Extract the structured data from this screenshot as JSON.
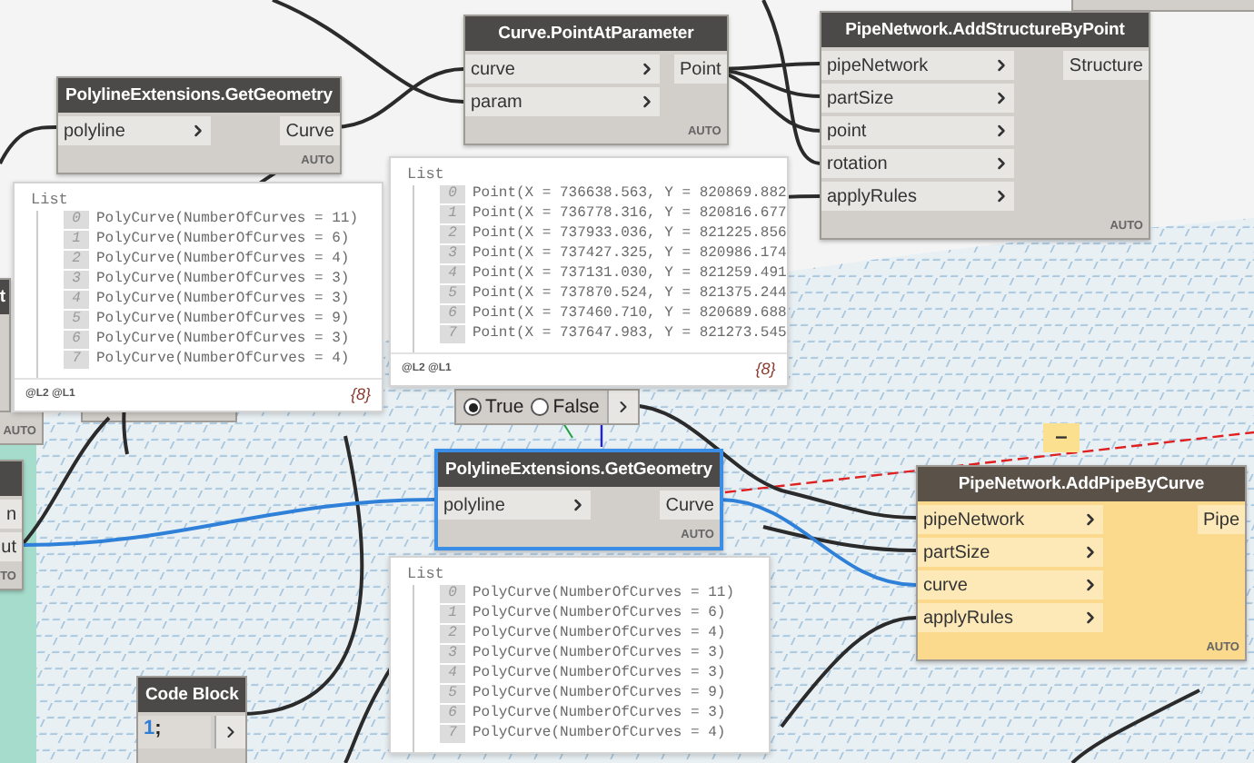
{
  "nodes": [
    {
      "title": "PolylineExtensions.GetGeometry",
      "selected": false,
      "warning": false,
      "inputs": [
        "polyline"
      ],
      "outputs": [
        "Curve"
      ],
      "lacing": "AUTO"
    },
    {
      "title": "Curve.PointAtParameter",
      "selected": false,
      "warning": false,
      "inputs": [
        "curve",
        "param"
      ],
      "outputs": [
        "Point"
      ],
      "lacing": "AUTO"
    },
    {
      "title": "PipeNetwork.AddStructureByPoint",
      "selected": false,
      "warning": false,
      "inputs": [
        "pipeNetwork",
        "partSize",
        "point",
        "rotation",
        "applyRules"
      ],
      "outputs": [
        "Structure"
      ],
      "lacing": "AUTO"
    },
    {
      "title": "t",
      "selected": false,
      "warning": false,
      "lacing": "AUTO"
    },
    {
      "selected": false,
      "warning": false,
      "outputs": [
        "n",
        "ut"
      ],
      "lacing": "TO"
    },
    {
      "title": "PolylineExtensions.GetGeometry",
      "selected": true,
      "warning": false,
      "inputs": [
        "polyline"
      ],
      "outputs": [
        "Curve"
      ],
      "lacing": "AUTO"
    },
    {
      "title": "PipeNetwork.AddPipeByCurve",
      "selected": false,
      "warning": true,
      "inputs": [
        "pipeNetwork",
        "partSize",
        "curve",
        "applyRules"
      ],
      "outputs": [
        "Pipe"
      ],
      "lacing": "AUTO"
    }
  ],
  "previews": [
    {
      "header": "List",
      "items": [
        {
          "index": "0",
          "text": "PolyCurve(NumberOfCurves = 11)"
        },
        {
          "index": "1",
          "text": "PolyCurve(NumberOfCurves = 6)"
        },
        {
          "index": "2",
          "text": "PolyCurve(NumberOfCurves = 4)"
        },
        {
          "index": "3",
          "text": "PolyCurve(NumberOfCurves = 3)"
        },
        {
          "index": "4",
          "text": "PolyCurve(NumberOfCurves = 3)"
        },
        {
          "index": "5",
          "text": "PolyCurve(NumberOfCurves = 9)"
        },
        {
          "index": "6",
          "text": "PolyCurve(NumberOfCurves = 3)"
        },
        {
          "index": "7",
          "text": "PolyCurve(NumberOfCurves = 4)"
        }
      ],
      "levels": [
        "@L2",
        "@L1"
      ],
      "count": "{8}"
    },
    {
      "header": "List",
      "items": [
        {
          "index": "0",
          "text": "Point(X = 736638.563, Y = 820869.882"
        },
        {
          "index": "1",
          "text": "Point(X = 736778.316, Y = 820816.677"
        },
        {
          "index": "2",
          "text": "Point(X = 737933.036, Y = 821225.856"
        },
        {
          "index": "3",
          "text": "Point(X = 737427.325, Y = 820986.174"
        },
        {
          "index": "4",
          "text": "Point(X = 737131.030, Y = 821259.491"
        },
        {
          "index": "5",
          "text": "Point(X = 737870.524, Y = 821375.244"
        },
        {
          "index": "6",
          "text": "Point(X = 737460.710, Y = 820689.688"
        },
        {
          "index": "7",
          "text": "Point(X = 737647.983, Y = 821273.545"
        }
      ],
      "levels": [
        "@L2",
        "@L1"
      ],
      "count": "{8}"
    },
    {
      "header": "List",
      "items": [
        {
          "index": "0",
          "text": "PolyCurve(NumberOfCurves = 11)"
        },
        {
          "index": "1",
          "text": "PolyCurve(NumberOfCurves = 6)"
        },
        {
          "index": "2",
          "text": "PolyCurve(NumberOfCurves = 4)"
        },
        {
          "index": "3",
          "text": "PolyCurve(NumberOfCurves = 3)"
        },
        {
          "index": "4",
          "text": "PolyCurve(NumberOfCurves = 3)"
        },
        {
          "index": "5",
          "text": "PolyCurve(NumberOfCurves = 9)"
        },
        {
          "index": "6",
          "text": "PolyCurve(NumberOfCurves = 3)"
        },
        {
          "index": "7",
          "text": "PolyCurve(NumberOfCurves = 4)"
        }
      ]
    }
  ],
  "boolean_node": {
    "options": [
      {
        "label": "True",
        "selected": true
      },
      {
        "label": "False",
        "selected": false
      }
    ]
  },
  "code_block": {
    "title": "Code Block",
    "tokens": [
      {
        "text": "1",
        "kind": "number"
      },
      {
        "text": ";",
        "kind": "plain"
      }
    ]
  },
  "warning_badge": {
    "text": "–"
  }
}
